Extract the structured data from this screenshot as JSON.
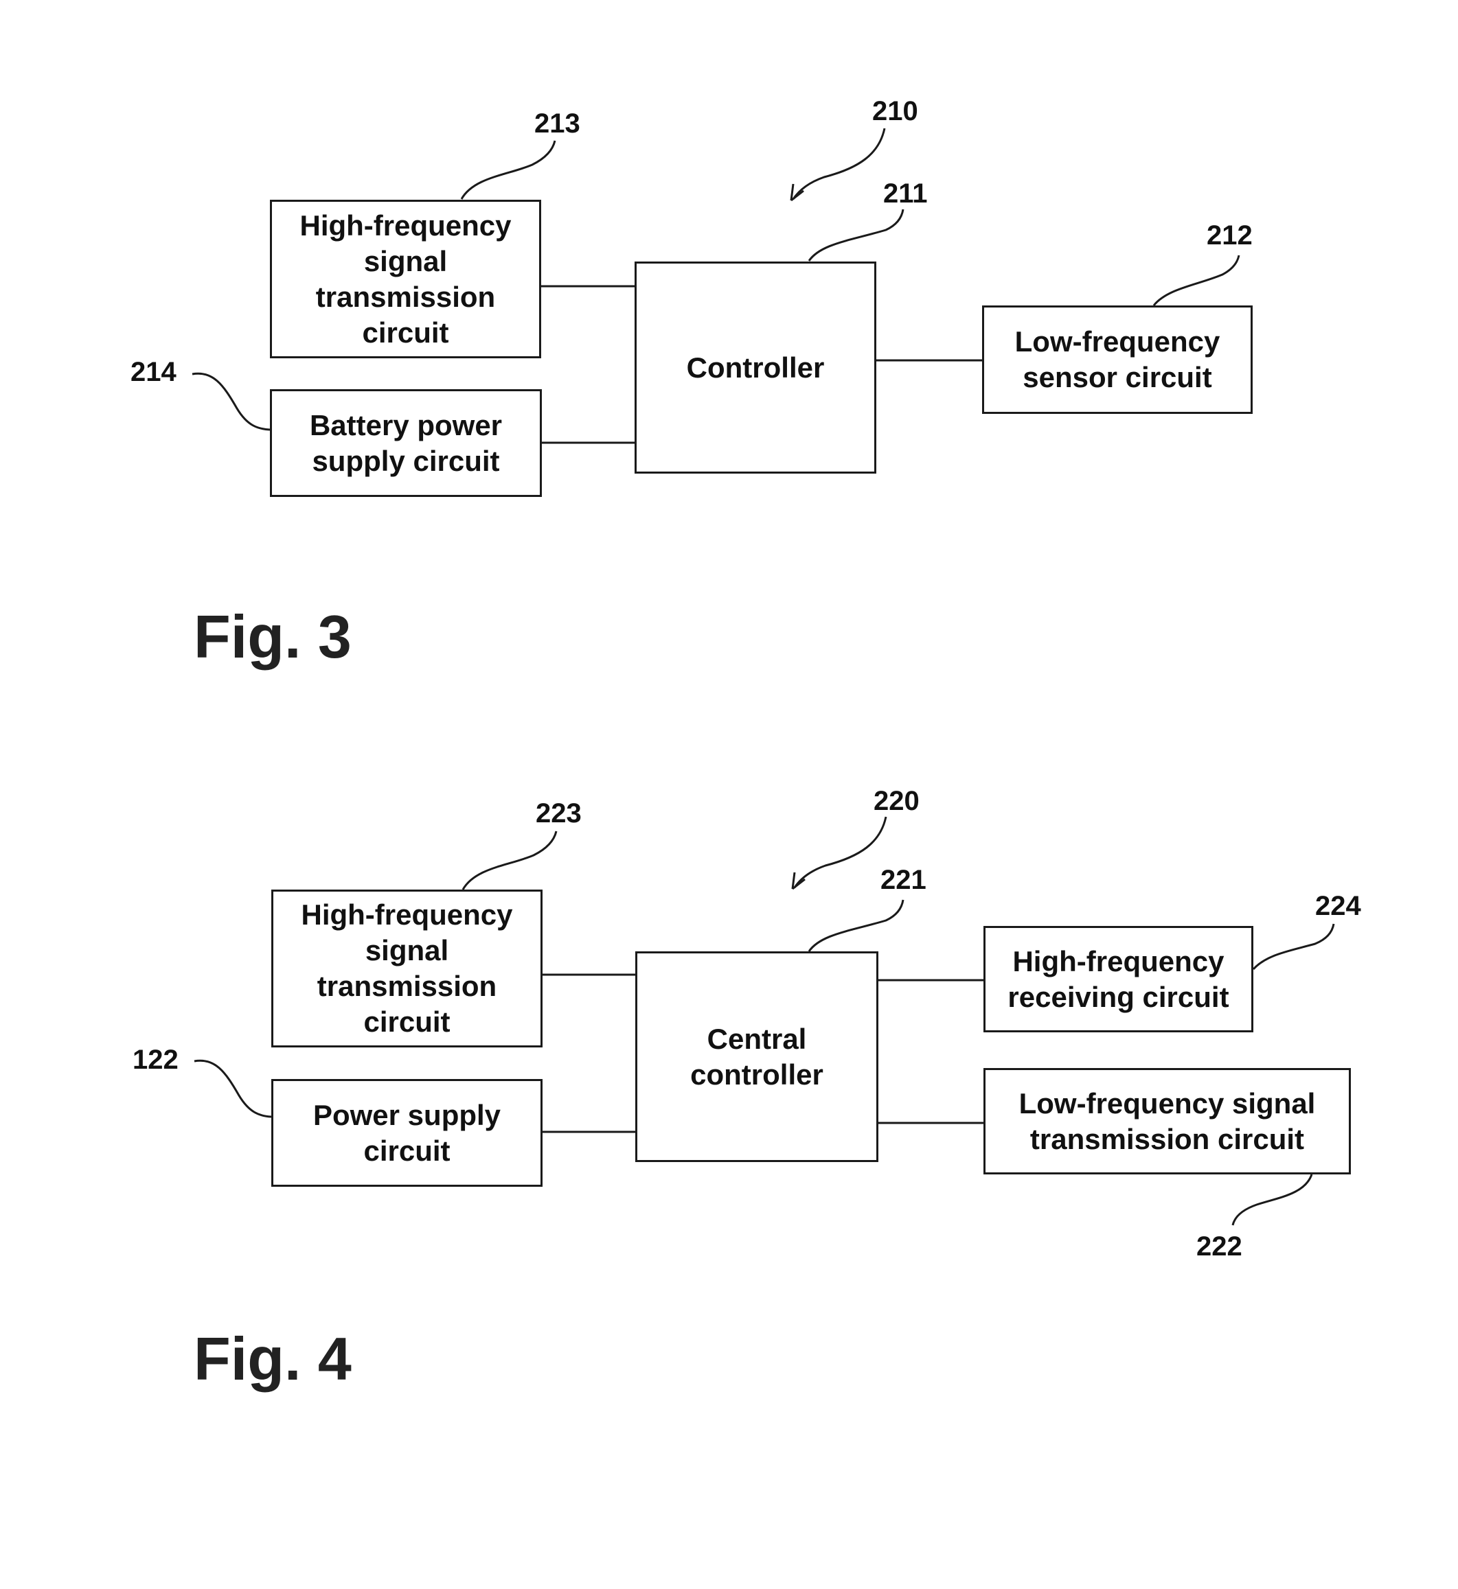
{
  "fig3": {
    "caption": "Fig. 3",
    "assembly_ref": "210",
    "controller": {
      "ref": "211",
      "label": "Controller"
    },
    "hf_transmission": {
      "ref": "213",
      "label": "High-frequency\nsignal\ntransmission\ncircuit"
    },
    "battery_power": {
      "ref": "214",
      "label": "Battery power\nsupply circuit"
    },
    "lf_sensor": {
      "ref": "212",
      "label": "Low-frequency\nsensor circuit"
    }
  },
  "fig4": {
    "caption": "Fig. 4",
    "assembly_ref": "220",
    "controller": {
      "ref": "221",
      "label": "Central\ncontroller"
    },
    "hf_transmission": {
      "ref": "223",
      "label": "High-frequency\nsignal\ntransmission\ncircuit"
    },
    "power_supply": {
      "ref": "122",
      "label": "Power supply\ncircuit"
    },
    "hf_receiving": {
      "ref": "224",
      "label": "High-frequency\nreceiving circuit"
    },
    "lf_transmission": {
      "ref": "222",
      "label": "Low-frequency signal\ntransmission circuit"
    }
  },
  "colors": {
    "line": "#1a1a1a",
    "background": "#ffffff"
  }
}
